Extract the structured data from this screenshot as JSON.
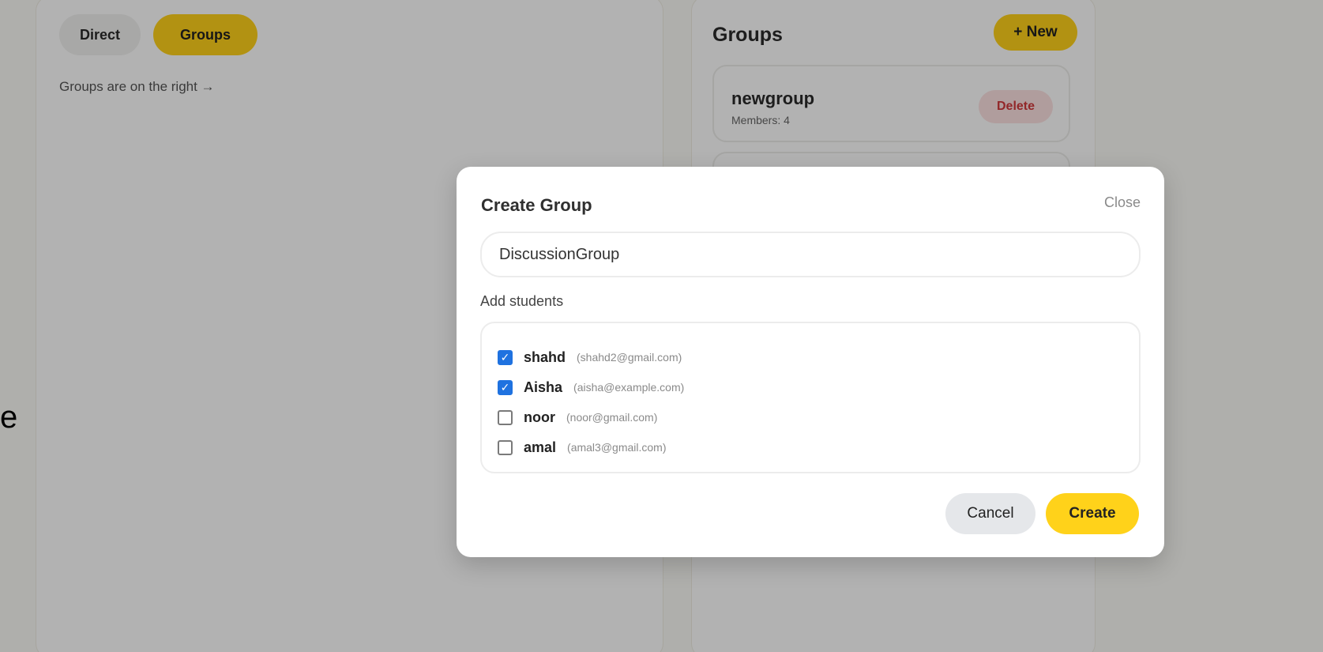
{
  "edge_text": "e",
  "tabs": {
    "direct": "Direct",
    "groups": "Groups"
  },
  "left_hint": "Groups are on the right →",
  "groups_panel": {
    "title": "Groups",
    "new_button": "+ New",
    "groups": [
      {
        "name": "newgroup",
        "members": "Members: 4",
        "delete_label": "Delete"
      }
    ]
  },
  "modal": {
    "title": "Create Group",
    "close_label": "Close",
    "name_input": {
      "value": "DiscussionGroup",
      "placeholder": ""
    },
    "section_label": "Add students",
    "students": [
      {
        "name": "shahd",
        "email": "(shahd2@gmail.com)",
        "checked": true
      },
      {
        "name": "Aisha",
        "email": "(aisha@example.com)",
        "checked": true
      },
      {
        "name": "noor",
        "email": "(noor@gmail.com)",
        "checked": false
      },
      {
        "name": "amal",
        "email": "(amal3@gmail.com)",
        "checked": false
      }
    ],
    "cancel_label": "Cancel",
    "create_label": "Create"
  },
  "colors": {
    "accent": "#ffd21a",
    "checkbox": "#1f72e0",
    "danger": "#d2383b"
  },
  "icons": {
    "checked": "checkbox-checked-icon",
    "unchecked": "checkbox-unchecked-icon"
  }
}
